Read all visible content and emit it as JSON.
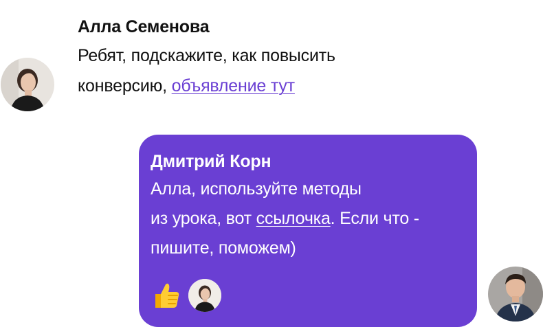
{
  "messages": {
    "incoming": {
      "sender": "Алла Семенова",
      "text_line1": "Ребят, подскажите, как повысить",
      "text_line2_prefix": "конверсию, ",
      "link_text": "объявление тут",
      "avatar_icon": "avatar-woman-icon"
    },
    "outgoing": {
      "sender": "Дмитрий Корн",
      "text_line1": "Алла, используйте методы",
      "text_line2_prefix": "из урока, вот ",
      "link_text": "ссылочка",
      "text_line2_suffix": ". Если что -",
      "text_line3": "пишите, поможем)",
      "avatar_icon": "avatar-man-icon",
      "reactions": {
        "emoji_icon": "thumbs-up-icon",
        "reactor_avatar_icon": "avatar-woman-icon"
      }
    }
  },
  "colors": {
    "accent": "#6A3FD3",
    "text": "#111111",
    "bubble_text": "#FFFFFF"
  }
}
